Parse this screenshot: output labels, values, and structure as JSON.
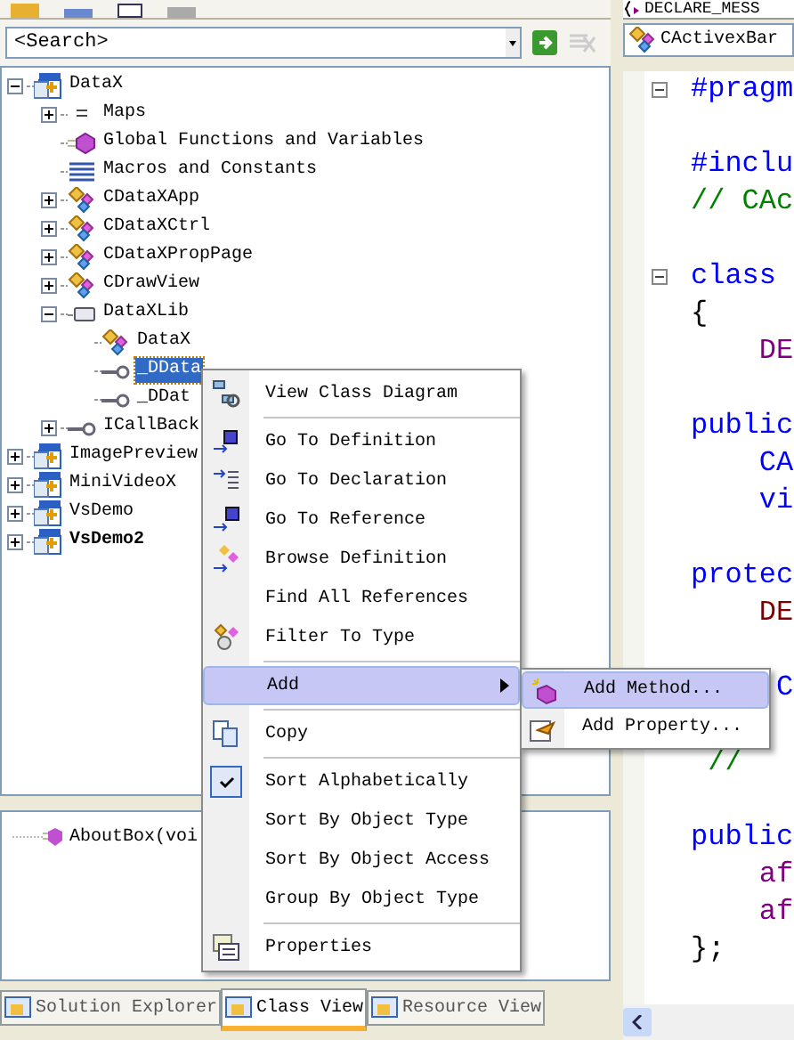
{
  "class_view": {
    "search": {
      "value": "<Search>"
    },
    "tree": [
      {
        "label": "DataX",
        "kind": "project",
        "expanded": true,
        "bold": false,
        "selected": false,
        "children": [
          {
            "label": "Maps",
            "kind": "maps",
            "expanded": false,
            "selected": false
          },
          {
            "label": "Global Functions and Variables",
            "kind": "global",
            "selected": false
          },
          {
            "label": "Macros and Constants",
            "kind": "macros",
            "selected": false
          },
          {
            "label": "CDataXApp",
            "kind": "class",
            "expanded": false,
            "selected": false
          },
          {
            "label": "CDataXCtrl",
            "kind": "class",
            "expanded": false,
            "selected": false
          },
          {
            "label": "CDataXPropPage",
            "kind": "class",
            "expanded": false,
            "selected": false
          },
          {
            "label": "CDrawView",
            "kind": "class",
            "expanded": false,
            "selected": false
          },
          {
            "label": "DataXLib",
            "kind": "library",
            "expanded": true,
            "selected": false,
            "children": [
              {
                "label": "DataX",
                "kind": "class",
                "selected": false
              },
              {
                "label": "_DData",
                "kind": "interface",
                "selected": true
              },
              {
                "label": "_DDat",
                "kind": "interface",
                "selected": false
              }
            ]
          },
          {
            "label": "ICallBack",
            "kind": "interface",
            "expanded": false,
            "selected": false
          }
        ]
      },
      {
        "label": "ImagePreview",
        "kind": "project",
        "expanded": false,
        "bold": false,
        "selected": false
      },
      {
        "label": "MiniVideoX",
        "kind": "project",
        "expanded": false,
        "bold": false,
        "selected": false
      },
      {
        "label": "VsDemo",
        "kind": "project",
        "expanded": false,
        "bold": false,
        "selected": false
      },
      {
        "label": "VsDemo2",
        "kind": "project",
        "expanded": false,
        "bold": true,
        "selected": false
      }
    ],
    "members": [
      {
        "label": "AboutBox(voi"
      }
    ],
    "tabs": [
      {
        "label": "Solution Explorer",
        "selected": false
      },
      {
        "label": "Class View",
        "selected": true
      },
      {
        "label": "Resource View",
        "selected": false
      }
    ]
  },
  "editor": {
    "header": "DECLARE_MESS",
    "type_combo": "CActivexBar",
    "lines": [
      {
        "kind": "keyword",
        "text": "#pragm",
        "fold": true
      },
      {
        "kind": "blank"
      },
      {
        "kind": "keyword",
        "text": "#inclu",
        "fold": false
      },
      {
        "kind": "comment",
        "text": "// CAc",
        "fold": false
      },
      {
        "kind": "blank"
      },
      {
        "kind": "keyword",
        "text": "class",
        "fold": true
      },
      {
        "kind": "plain",
        "text": "{",
        "fold": false
      },
      {
        "kind": "macro",
        "text": "    DE",
        "fold": false
      },
      {
        "kind": "blank"
      },
      {
        "kind": "keyword",
        "text": "public",
        "fold": false
      },
      {
        "kind": "keyword",
        "text": "    CA",
        "fold": false
      },
      {
        "kind": "keyword",
        "text": "    vi",
        "fold": false
      },
      {
        "kind": "blank"
      },
      {
        "kind": "keyword",
        "text": "protec",
        "fold": false
      },
      {
        "kind": "member",
        "text": "    DE",
        "fold": false
      },
      {
        "kind": "blank"
      },
      {
        "kind": "keyword",
        "text": "     C"
      },
      {
        "kind": "blank"
      },
      {
        "kind": "comment",
        "text": " //",
        "fold": false
      },
      {
        "kind": "blank"
      },
      {
        "kind": "keyword",
        "text": "public",
        "fold": false
      },
      {
        "kind": "macro",
        "text": "    af",
        "fold": false
      },
      {
        "kind": "macro",
        "text": "    af",
        "fold": false
      },
      {
        "kind": "plain",
        "text": "};",
        "fold": false
      }
    ]
  },
  "context_menu": {
    "items": [
      {
        "kind": "item",
        "label": "View Class Diagram",
        "selected": false,
        "checked": false
      },
      {
        "kind": "separator"
      },
      {
        "kind": "item",
        "label": "Go To Definition",
        "selected": false,
        "checked": false
      },
      {
        "kind": "item",
        "label": "Go To Declaration",
        "selected": false,
        "checked": false
      },
      {
        "kind": "item",
        "label": "Go To Reference",
        "selected": false,
        "checked": false
      },
      {
        "kind": "item",
        "label": "Browse Definition",
        "selected": false,
        "checked": false
      },
      {
        "kind": "item",
        "label": "Find All References",
        "selected": false,
        "checked": false
      },
      {
        "kind": "item",
        "label": "Filter To Type",
        "selected": false,
        "checked": false
      },
      {
        "kind": "separator"
      },
      {
        "kind": "submenu",
        "label": "Add",
        "selected": true,
        "checked": false
      },
      {
        "kind": "separator"
      },
      {
        "kind": "item",
        "label": "Copy",
        "selected": false,
        "checked": false
      },
      {
        "kind": "separator"
      },
      {
        "kind": "item",
        "label": "Sort Alphabetically",
        "selected": false,
        "checked": true
      },
      {
        "kind": "item",
        "label": "Sort By Object Type",
        "selected": false,
        "checked": false
      },
      {
        "kind": "item",
        "label": "Sort By Object Access",
        "selected": false,
        "checked": false
      },
      {
        "kind": "item",
        "label": "Group By Object Type",
        "selected": false,
        "checked": false
      },
      {
        "kind": "separator"
      },
      {
        "kind": "item",
        "label": "Properties",
        "selected": false,
        "checked": false
      }
    ]
  },
  "submenu": {
    "items": [
      {
        "label": "Add Method...",
        "selected": true
      },
      {
        "label": "Add Property...",
        "selected": false
      }
    ]
  }
}
